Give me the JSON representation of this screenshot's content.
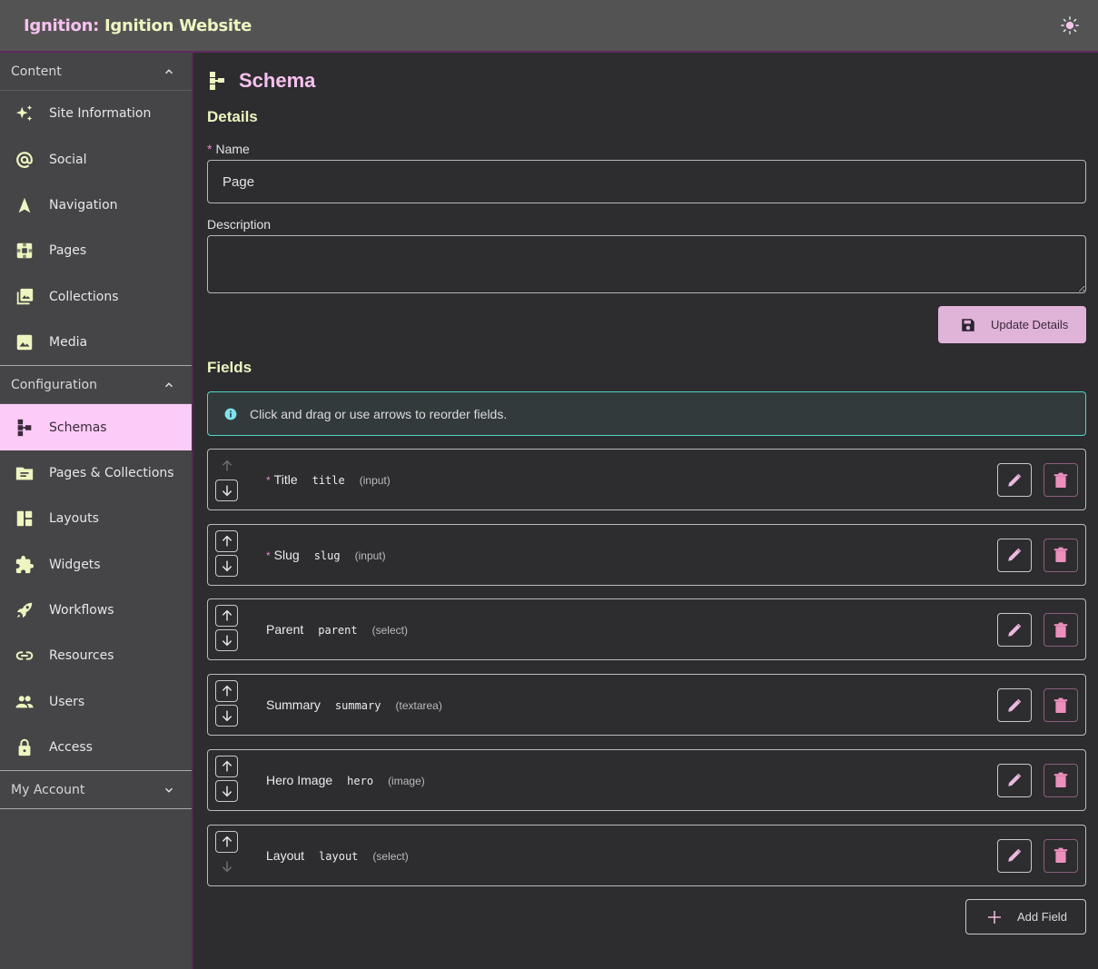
{
  "header": {
    "title_prefix": "Ignition:",
    "title_site": " Ignition Website",
    "theme_toggle_icon": "sun-icon"
  },
  "sidebar": {
    "sections": [
      {
        "label": "Content",
        "expanded": true,
        "items": [
          {
            "label": "Site Information",
            "icon": "sparkles-icon"
          },
          {
            "label": "Social",
            "icon": "at-sign-icon"
          },
          {
            "label": "Navigation",
            "icon": "navigation-arrow-icon"
          },
          {
            "label": "Pages",
            "icon": "pages-icon"
          },
          {
            "label": "Collections",
            "icon": "image-stack-icon"
          },
          {
            "label": "Media",
            "icon": "image-icon"
          }
        ]
      },
      {
        "label": "Configuration",
        "expanded": true,
        "items": [
          {
            "label": "Schemas",
            "icon": "schema-icon",
            "active": true
          },
          {
            "label": "Pages & Collections",
            "icon": "folder-icon"
          },
          {
            "label": "Layouts",
            "icon": "layout-icon"
          },
          {
            "label": "Widgets",
            "icon": "puzzle-icon"
          },
          {
            "label": "Workflows",
            "icon": "rocket-icon"
          },
          {
            "label": "Resources",
            "icon": "link-icon"
          },
          {
            "label": "Users",
            "icon": "users-icon"
          },
          {
            "label": "Access",
            "icon": "lock-icon"
          }
        ]
      },
      {
        "label": "My Account",
        "expanded": false,
        "items": []
      }
    ]
  },
  "main": {
    "page_title": "Schema",
    "details_heading": "Details",
    "name_label": "Name",
    "name_required_marker": "*",
    "name_value": "Page",
    "description_label": "Description",
    "description_value": "",
    "update_button": "Update Details",
    "fields_heading": "Fields",
    "info_message": "Click and drag or use arrows to reorder fields.",
    "fields": [
      {
        "label": "Title",
        "key": "title",
        "type": "(input)",
        "required": true,
        "can_move_up": false,
        "can_move_down": true
      },
      {
        "label": "Slug",
        "key": "slug",
        "type": "(input)",
        "required": true,
        "can_move_up": true,
        "can_move_down": true
      },
      {
        "label": "Parent",
        "key": "parent",
        "type": "(select)",
        "required": false,
        "can_move_up": true,
        "can_move_down": true
      },
      {
        "label": "Summary",
        "key": "summary",
        "type": "(textarea)",
        "required": false,
        "can_move_up": true,
        "can_move_down": true
      },
      {
        "label": "Hero Image",
        "key": "hero",
        "type": "(image)",
        "required": false,
        "can_move_up": true,
        "can_move_down": true
      },
      {
        "label": "Layout",
        "key": "layout",
        "type": "(select)",
        "required": false,
        "can_move_up": true,
        "can_move_down": false
      }
    ],
    "add_field_button": "Add Field"
  },
  "colors": {
    "accent_pink": "#f6c1ee",
    "accent_lime": "#eef5c0",
    "active_nav_bg": "#fccbf8",
    "update_button_bg": "#e0b3d9",
    "info_border": "#4fd6c9",
    "delete_icon": "#ec8fbd"
  }
}
